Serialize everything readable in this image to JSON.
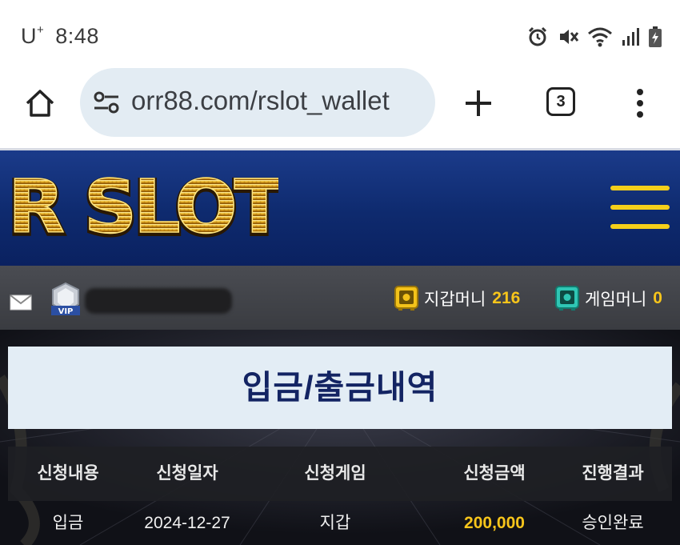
{
  "status_bar": {
    "carrier": "U",
    "carrier_sup": "+",
    "time": "8:48",
    "icons": [
      "alarm-icon",
      "mute-icon",
      "wifi-icon",
      "signal-icon",
      "battery-icon"
    ]
  },
  "browser": {
    "url": "orr88.com/rslot_wallet",
    "tab_count": "3",
    "icons": [
      "home-icon",
      "site-settings-icon",
      "new-tab-icon",
      "tab-switcher-icon",
      "more-menu-icon"
    ]
  },
  "site": {
    "logo_text": "R SLOT",
    "accent_gold": "#f5cf1a",
    "header_blue": "#0e2a6e"
  },
  "user": {
    "badge": "VIP",
    "wallet_label": "지갑머니",
    "wallet_value": "216",
    "game_label": "게임머니",
    "game_value": "0"
  },
  "page": {
    "title": "입금/출금내역"
  },
  "table": {
    "headers": [
      "신청내용",
      "신청일자",
      "신청게임",
      "신청금액",
      "진행결과"
    ],
    "rows": [
      [
        "입금",
        "2024-12-27",
        "지갑",
        "200,000",
        "승인완료"
      ]
    ]
  }
}
